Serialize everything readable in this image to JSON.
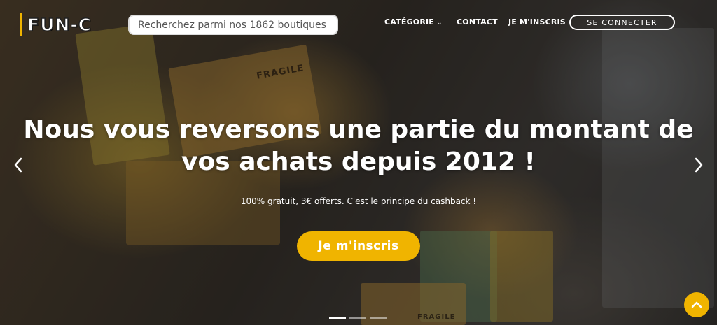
{
  "header": {
    "logo_text": "FUN-C",
    "search": {
      "placeholder": "Recherchez parmi nos 1862 boutiques",
      "value": ""
    },
    "nav": {
      "category_label": "CATÉGORIE",
      "contact_label": "CONTACT",
      "signup_label": "JE M'INSCRIS",
      "login_label": "SE CONNECTER"
    }
  },
  "hero": {
    "title_line1": "Nous vous reversons une partie du montant de",
    "title_line2": "vos achats depuis 2012 !",
    "subtitle": "100% gratuit, 3€ offerts. C'est le principe du cashback !",
    "cta_label": "Je m'inscris",
    "fragile_label": "FRAGILE",
    "slides": {
      "count": 3,
      "active": 1
    }
  },
  "icons": {
    "prev": "chevron-left-icon",
    "next": "chevron-right-icon",
    "scroll_top": "chevron-up-icon",
    "dropdown": "chevron-down-icon"
  },
  "colors": {
    "accent": "#f0b400",
    "text": "#ffffff"
  }
}
